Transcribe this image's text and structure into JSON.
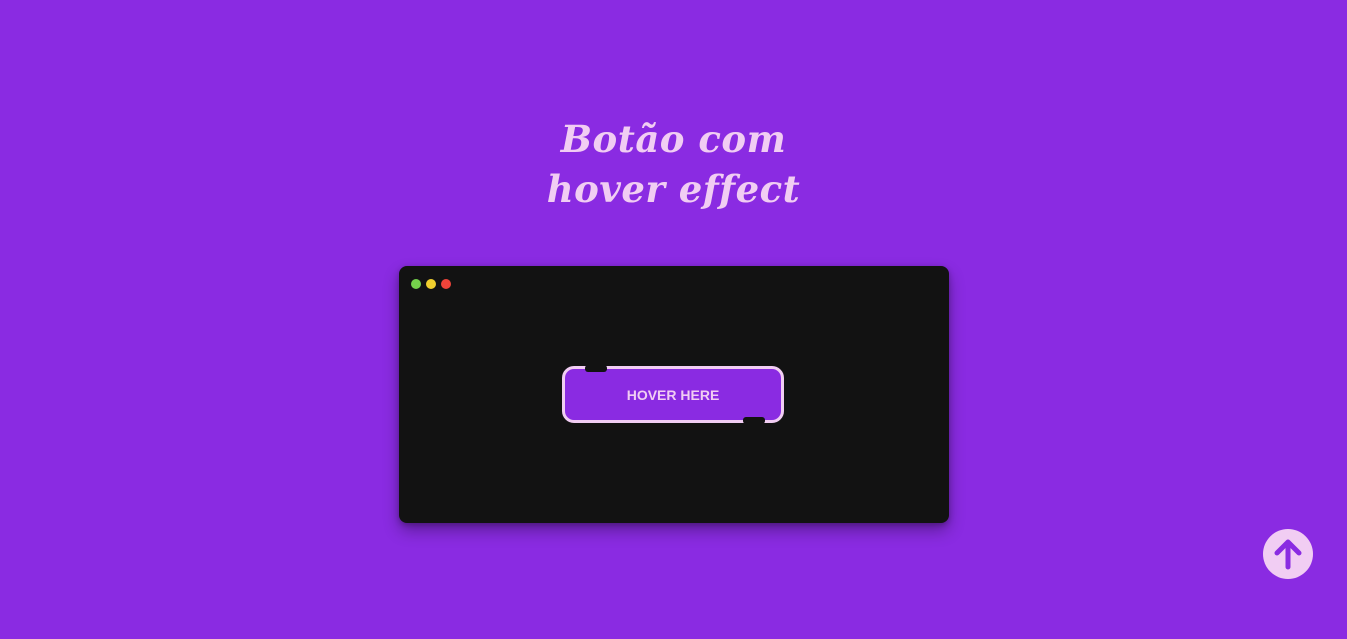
{
  "heading": {
    "line1": "Botão com",
    "line2": "hover effect"
  },
  "window": {
    "dots": [
      {
        "name": "green-dot",
        "color": "#74d14b"
      },
      {
        "name": "yellow-dot",
        "color": "#f0cf2e"
      },
      {
        "name": "red-dot",
        "color": "#f0443a"
      }
    ]
  },
  "button": {
    "label": "HOVER HERE"
  },
  "scroll_top": {
    "icon": "arrow-up-icon"
  },
  "colors": {
    "background": "#8a2be2",
    "accent": "#f1cdf3",
    "window": "#121212"
  }
}
